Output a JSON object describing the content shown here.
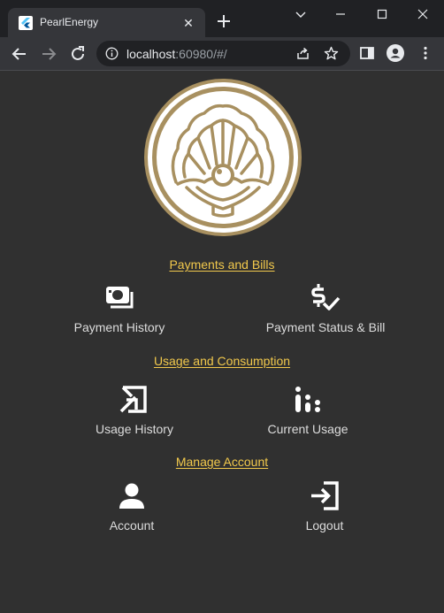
{
  "browser": {
    "tab_title": "PearlEnergy",
    "url_host": "localhost",
    "url_rest": ":60980/#/"
  },
  "sections": [
    {
      "title": "Payments and Bills",
      "items": [
        {
          "label": "Payment History",
          "icon": "payments-icon"
        },
        {
          "label": "Payment Status & Bill",
          "icon": "price-check-icon"
        }
      ]
    },
    {
      "title": "Usage and Consumption",
      "items": [
        {
          "label": "Usage History",
          "icon": "usage-history-icon"
        },
        {
          "label": "Current Usage",
          "icon": "current-usage-icon"
        }
      ]
    },
    {
      "title": "Manage Account",
      "items": [
        {
          "label": "Account",
          "icon": "person-icon"
        },
        {
          "label": "Logout",
          "icon": "logout-icon"
        }
      ]
    }
  ],
  "colors": {
    "accent": "#f2c94c",
    "logo_gold": "#a89060",
    "page_bg": "#303030"
  }
}
